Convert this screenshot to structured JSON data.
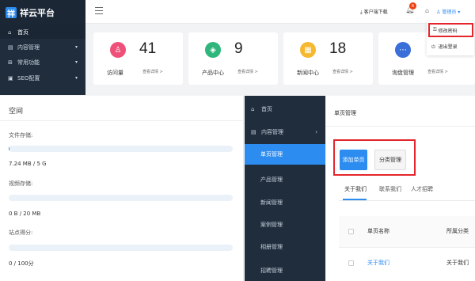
{
  "top": {
    "logo": {
      "mark": "祥",
      "text": "祥云平台"
    },
    "sidebar": [
      {
        "label": "首页",
        "icon": "home-icon",
        "glyph": "⌂"
      },
      {
        "label": "内容管理",
        "icon": "document-icon",
        "glyph": "▤"
      },
      {
        "label": "常用功能",
        "icon": "grid-icon",
        "glyph": "⊞"
      },
      {
        "label": "SEO配置",
        "icon": "chart-icon",
        "glyph": "▣"
      }
    ],
    "header": {
      "client_download": "客户端下载",
      "bell_count": "6",
      "user": "管理员"
    },
    "cards": [
      {
        "value": "41",
        "label": "访问量",
        "more": "查看详情 >",
        "color": "#ef5079",
        "icon": "user-icon",
        "glyph": "♙"
      },
      {
        "value": "9",
        "label": "产品中心",
        "more": "查看详情 >",
        "color": "#2fb67c",
        "icon": "layers-icon",
        "glyph": "◈"
      },
      {
        "value": "18",
        "label": "新闻中心",
        "more": "查看详情 >",
        "color": "#f5b82e",
        "icon": "news-icon",
        "glyph": "▦"
      },
      {
        "value": "",
        "label": "询盘管理",
        "more": "查看详情 >",
        "color": "#3a6ed8",
        "icon": "message-icon",
        "glyph": "⋯"
      }
    ],
    "dropdown": {
      "change_password": "修改密码",
      "logout": "退出登录"
    }
  },
  "storage": {
    "title": "空间",
    "file_label": "文件存储:",
    "file_value": "7.24 MB / 5 G",
    "file_progress": 0.0014,
    "video_label": "视频存储:",
    "video_value": "0 B / 20 MB",
    "video_progress": 0,
    "score_label": "站点得分:",
    "score_value": "0 / 100分",
    "score_progress": 0
  },
  "sidebar2": {
    "items": [
      {
        "label": "首页",
        "icon": "home-icon",
        "glyph": "⌂",
        "top": true
      },
      {
        "label": "内容管理",
        "icon": "document-icon",
        "glyph": "▤",
        "top": true,
        "chevron": "›"
      },
      {
        "label": "单页管理",
        "active": true
      },
      {
        "label": "产品管理"
      },
      {
        "label": "新闻管理"
      },
      {
        "label": "案例管理"
      },
      {
        "label": "相册管理"
      },
      {
        "label": "招聘管理"
      }
    ]
  },
  "pages": {
    "breadcrumb": "单页管理",
    "add_button": "添加单页",
    "category_button": "分类管理",
    "tabs": [
      "关于我们",
      "联系我们",
      "人才招聘"
    ],
    "columns": [
      "单页名称",
      "所属分类"
    ],
    "rows": [
      {
        "name": "关于我们",
        "category": "关于我们"
      }
    ],
    "link_color": "#2d8cf0"
  }
}
